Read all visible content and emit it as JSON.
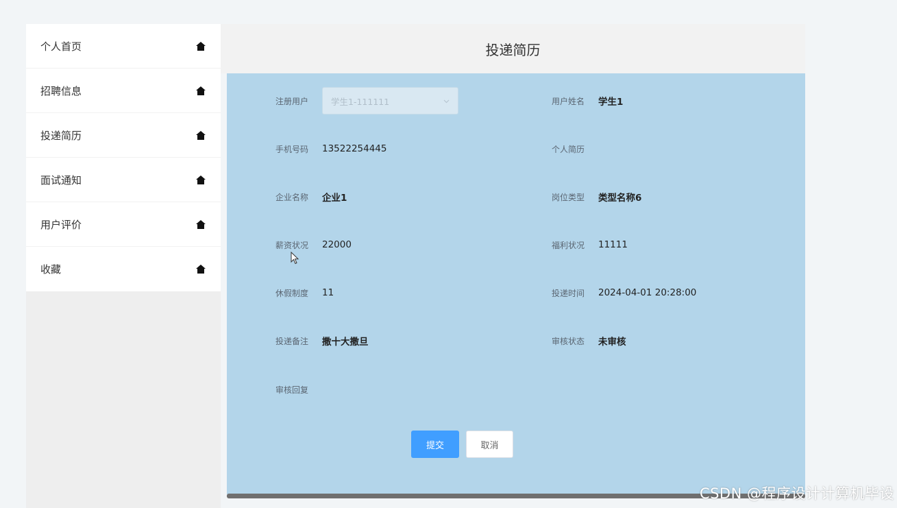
{
  "sidebar": {
    "items": [
      {
        "label": "个人首页",
        "icon": "home-icon"
      },
      {
        "label": "招聘信息",
        "icon": "home-icon"
      },
      {
        "label": "投递简历",
        "icon": "home-icon"
      },
      {
        "label": "面试通知",
        "icon": "home-icon"
      },
      {
        "label": "用户评价",
        "icon": "home-icon"
      },
      {
        "label": "收藏",
        "icon": "home-icon"
      }
    ]
  },
  "header": {
    "title": "投递简历"
  },
  "form": {
    "register_user": {
      "label": "注册用户",
      "value": "学生1-111111"
    },
    "user_name": {
      "label": "用户姓名",
      "value": "学生1"
    },
    "phone": {
      "label": "手机号码",
      "value": "13522254445"
    },
    "resume": {
      "label": "个人简历",
      "value": ""
    },
    "company": {
      "label": "企业名称",
      "value": "企业1"
    },
    "job_type": {
      "label": "岗位类型",
      "value": "类型名称6"
    },
    "salary": {
      "label": "薪资状况",
      "value": "22000"
    },
    "welfare": {
      "label": "福利状况",
      "value": "11111"
    },
    "vacation": {
      "label": "休假制度",
      "value": "11"
    },
    "submit_time": {
      "label": "投递时间",
      "value": "2024-04-01 20:28:00"
    },
    "remark": {
      "label": "投递备注",
      "value": "撒十大撒旦"
    },
    "review_status": {
      "label": "审核状态",
      "value": "未审核"
    },
    "review_reply": {
      "label": "审核回复",
      "value": ""
    }
  },
  "buttons": {
    "submit": "提交",
    "cancel": "取消"
  },
  "watermark": "CSDN @程序设计计算机毕设",
  "colors": {
    "panel": "#b3d5ea",
    "primary": "#409eff",
    "header": "#f2f2f2"
  }
}
